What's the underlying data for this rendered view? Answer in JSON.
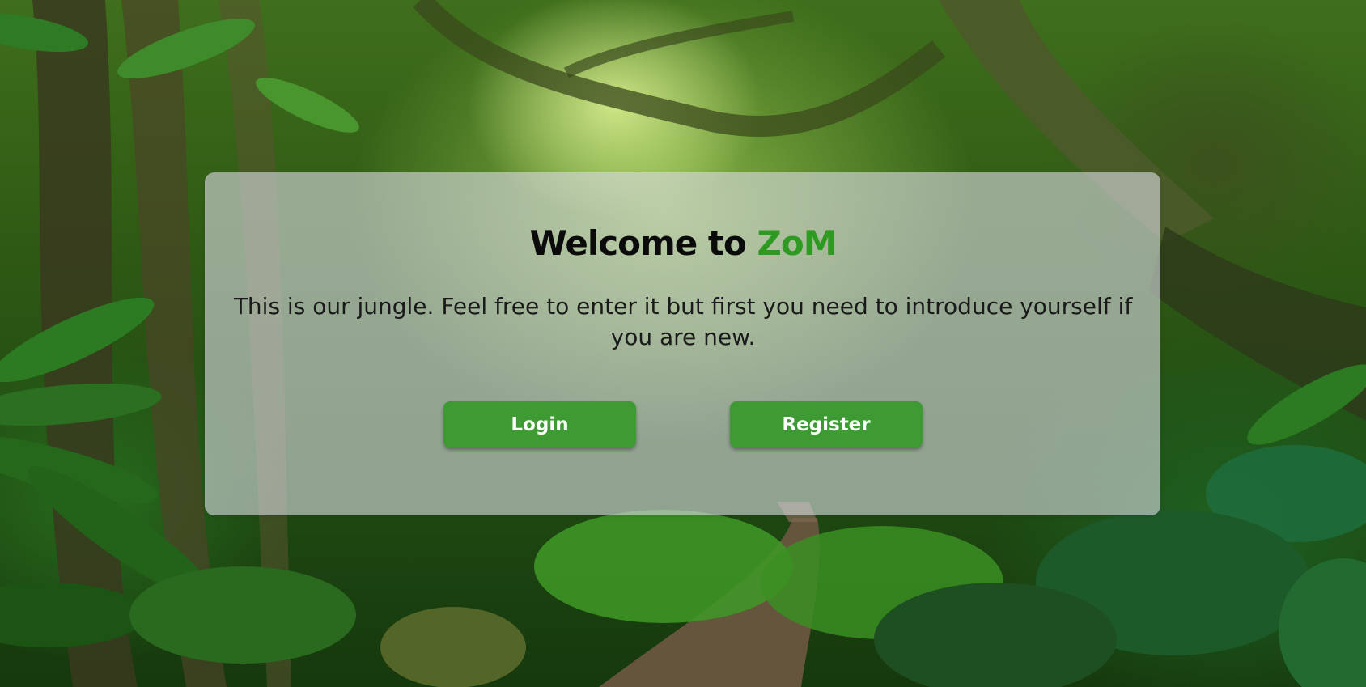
{
  "welcome": {
    "title_prefix": "Welcome to ",
    "brand_name": "ZoM",
    "brand_color": "#2e9a22",
    "message": "This is our jungle. Feel free to enter it but first you need to introduce yourself if you are new."
  },
  "actions": {
    "login_label": "Login",
    "register_label": "Register",
    "button_color": "#3e9b34"
  },
  "background": {
    "scene": "jungle-forest-path-image"
  }
}
